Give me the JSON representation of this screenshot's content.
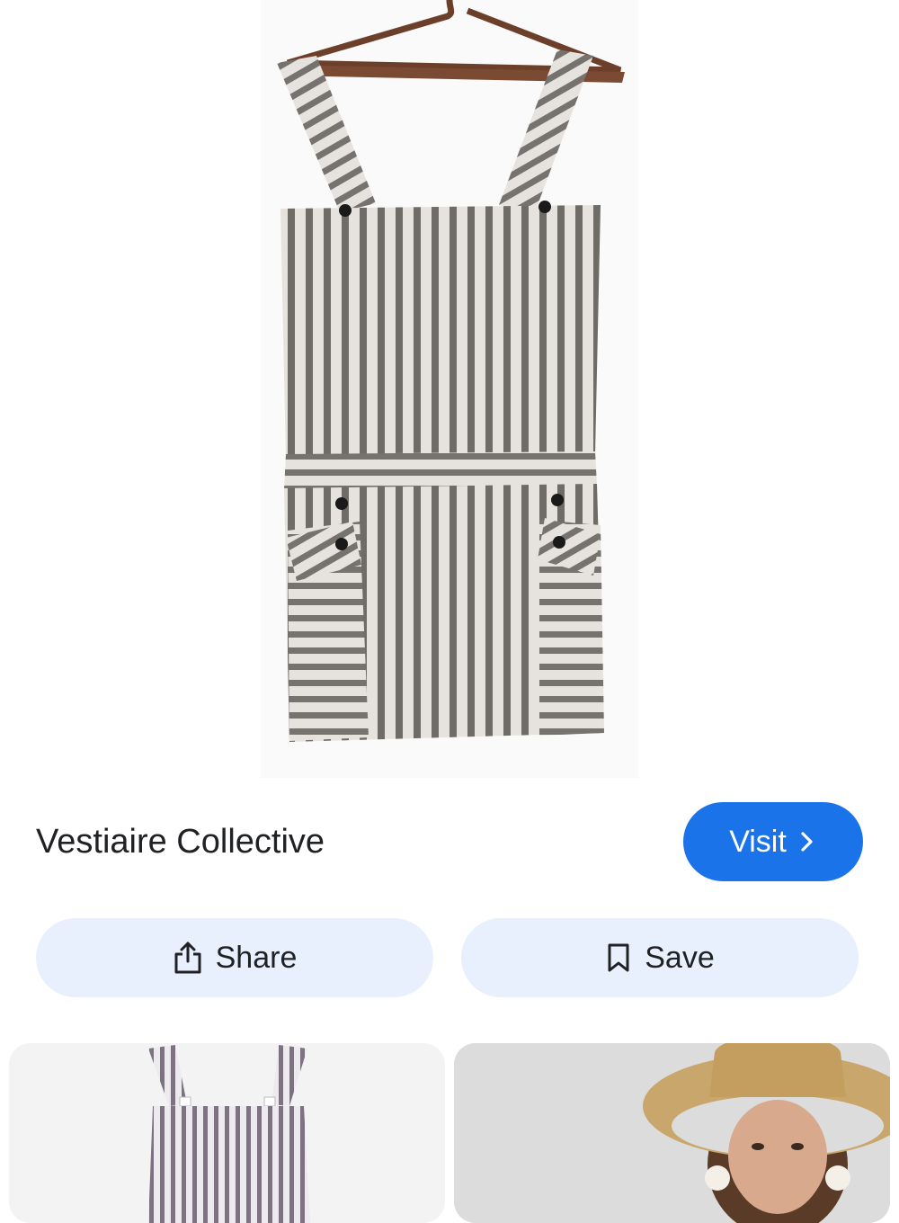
{
  "result": {
    "source_name": "Vestiaire Collective",
    "visit_label": "Visit",
    "share_label": "Share",
    "save_label": "Save"
  },
  "icons": {
    "visit": "chevron-right-icon",
    "share": "share-icon",
    "save": "bookmark-icon"
  },
  "colors": {
    "accent": "#1a73e8",
    "pill_bg": "#e8f0fe",
    "text": "#202124"
  }
}
